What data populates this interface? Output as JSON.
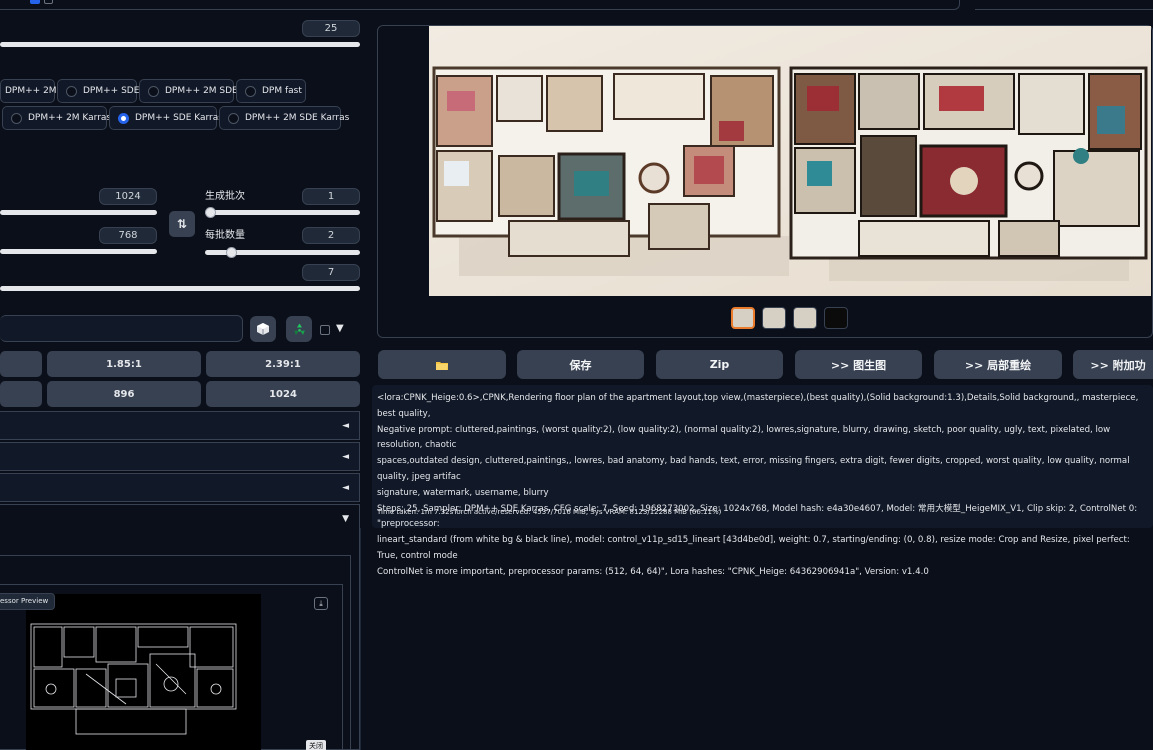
{
  "sliders": {
    "steps_value": "25",
    "width_value": "1024",
    "height_value": "768",
    "cfg_value": "7",
    "batch_count_label": "生成批次",
    "batch_count_value": "1",
    "batch_size_label": "每批数量",
    "batch_size_value": "2",
    "swap_icon": "⇅"
  },
  "samplers": {
    "row1": [
      "DPM++ 2M",
      "DPM++ SDE",
      "DPM++ 2M SDE",
      "DPM fast"
    ],
    "row2": [
      "DPM++ 2M Karras",
      "DPM++ SDE Karras",
      "DPM++ 2M SDE Karras"
    ],
    "selected": "DPM++ SDE Karras"
  },
  "seed": {
    "dice_icon": "dice-icon",
    "recycle_icon": "recycle-icon",
    "extra_arrow": "▼"
  },
  "ratios": {
    "row1": [
      "1.85:1",
      "2.39:1"
    ],
    "row2": [
      "896",
      "1024"
    ]
  },
  "accordions": {
    "arrow_left": "◄",
    "arrow_down": "▼"
  },
  "controlnet": {
    "preview_label": "essor Preview",
    "download_icon": "⤓",
    "close_label": "关闭"
  },
  "actions": {
    "folder_icon": "folder-icon",
    "save": "保存",
    "zip": "Zip",
    "img2img": ">> 图生图",
    "inpaint": ">> 局部重绘",
    "extras": ">> 附加功"
  },
  "generation_info": {
    "text": "<lora:CPNK_Heige:0.6>,CPNK,Rendering floor plan of the apartment layout,top view,(masterpiece),(best quality),(Solid background:1.3),Details,Solid background,, masterpiece, best quality,\nNegative prompt: cluttered,paintings, (worst quality:2), (low quality:2), (normal quality:2), lowres,signature, blurry, drawing, sketch, poor quality, ugly, text, pixelated, low resolution, chaotic\nspaces,outdated design, cluttered,paintings,, lowres, bad anatomy, bad hands, text, error, missing fingers, extra digit, fewer digits, cropped, worst quality, low quality, normal quality, jpeg artifac\nsignature, watermark, username, blurry\nSteps: 25, Sampler: DPM++ SDE Karras, CFG scale: 7, Seed: 1968273002, Size: 1024x768, Model hash: e4a30e4607, Model: 常用大模型_HeigeMIX_V1, Clip skip: 2, ControlNet 0: \"preprocessor:\nlineart_standard (from white bg & black line), model: control_v11p_sd15_lineart [43d4be0d], weight: 0.7, starting/ending: (0, 0.8), resize mode: Crop and Resize, pixel perfect: True, control mode\nControlNet is more important, preprocessor params: (512, 64, 64)\", Lora hashes: \"CPNK_Heige: 64362906941a\", Version: v1.4.0",
    "time_taken": "Time taken: 1m 7.32sTorch active/reserved: 4537/7016 MiB, Sys VRAM: 8123/12288 MiB (66.11%)"
  }
}
